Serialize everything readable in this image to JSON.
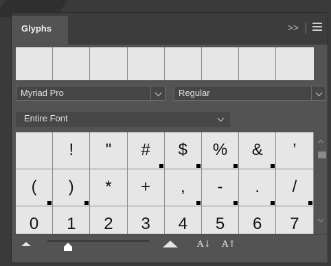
{
  "panel": {
    "tab_label": "Glyphs",
    "collapse_icon": "double-chevron-right",
    "collapse_symbol": ">>",
    "menu_icon": "hamburger-menu"
  },
  "recent_glyphs": [
    "",
    "",
    "",
    "",
    "",
    "",
    "",
    ""
  ],
  "font_family": "Myriad Pro",
  "font_style": "Regular",
  "show": "Entire Font",
  "glyphs": [
    "",
    "!",
    "\"",
    "#",
    "$",
    "%",
    "&",
    "’",
    "(",
    ")",
    "*",
    "+",
    ",",
    "-",
    ".",
    "/",
    "0",
    "1",
    "2",
    "3",
    "4",
    "5",
    "6",
    "7"
  ],
  "alternates_marker": [
    false,
    false,
    false,
    true,
    true,
    true,
    true,
    false,
    true,
    true,
    false,
    false,
    true,
    true,
    true,
    true,
    false,
    false,
    false,
    false,
    false,
    false,
    false,
    false
  ],
  "footer": {
    "zoom_out_icon": "small-mountain-icon",
    "zoom_in_icon": "large-mountain-icon",
    "decrease_font_label": "A↓",
    "increase_font_label": "A↑",
    "zoom_level": 0.2
  }
}
